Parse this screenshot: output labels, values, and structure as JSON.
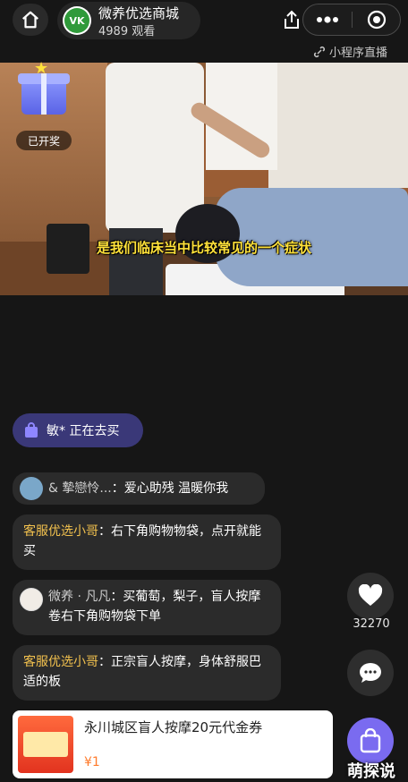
{
  "top_bar": {
    "channel_name": "微养优选商城",
    "channel_viewers": "4989 观看",
    "channel_logo_text": "VK",
    "miniprogram_label": "小程序直播"
  },
  "video": {
    "subtitle": "是我们临床当中比较常见的一个症状",
    "gift_label": "已开奖"
  },
  "purchase_notice": {
    "text": "敏* 正在去买"
  },
  "comments": [
    {
      "user": "& 摯戀怜...",
      "sep": "：",
      "text": "爱心助残 温暖你我"
    },
    {
      "user": "客服优选小哥",
      "sep": "：",
      "text": "右下角购物物袋，点开就能买"
    },
    {
      "user": "微养 · 凡凡",
      "sep": "：",
      "text": "买葡萄，梨子，盲人按摩卷右下角购物袋下单"
    },
    {
      "user": "客服优选小哥",
      "sep": "：",
      "text": "正宗盲人按摩，身体舒服巴适的板"
    }
  ],
  "actions": {
    "like_count": "32270"
  },
  "product": {
    "title": "永川城区盲人按摩20元代金券",
    "price": "¥1"
  },
  "watermark": "萌探说",
  "colors": {
    "accent": "#7a6bf0",
    "username": "#f3c24e",
    "subtitle": "#ffe23a",
    "price": "#ff7b2c"
  }
}
